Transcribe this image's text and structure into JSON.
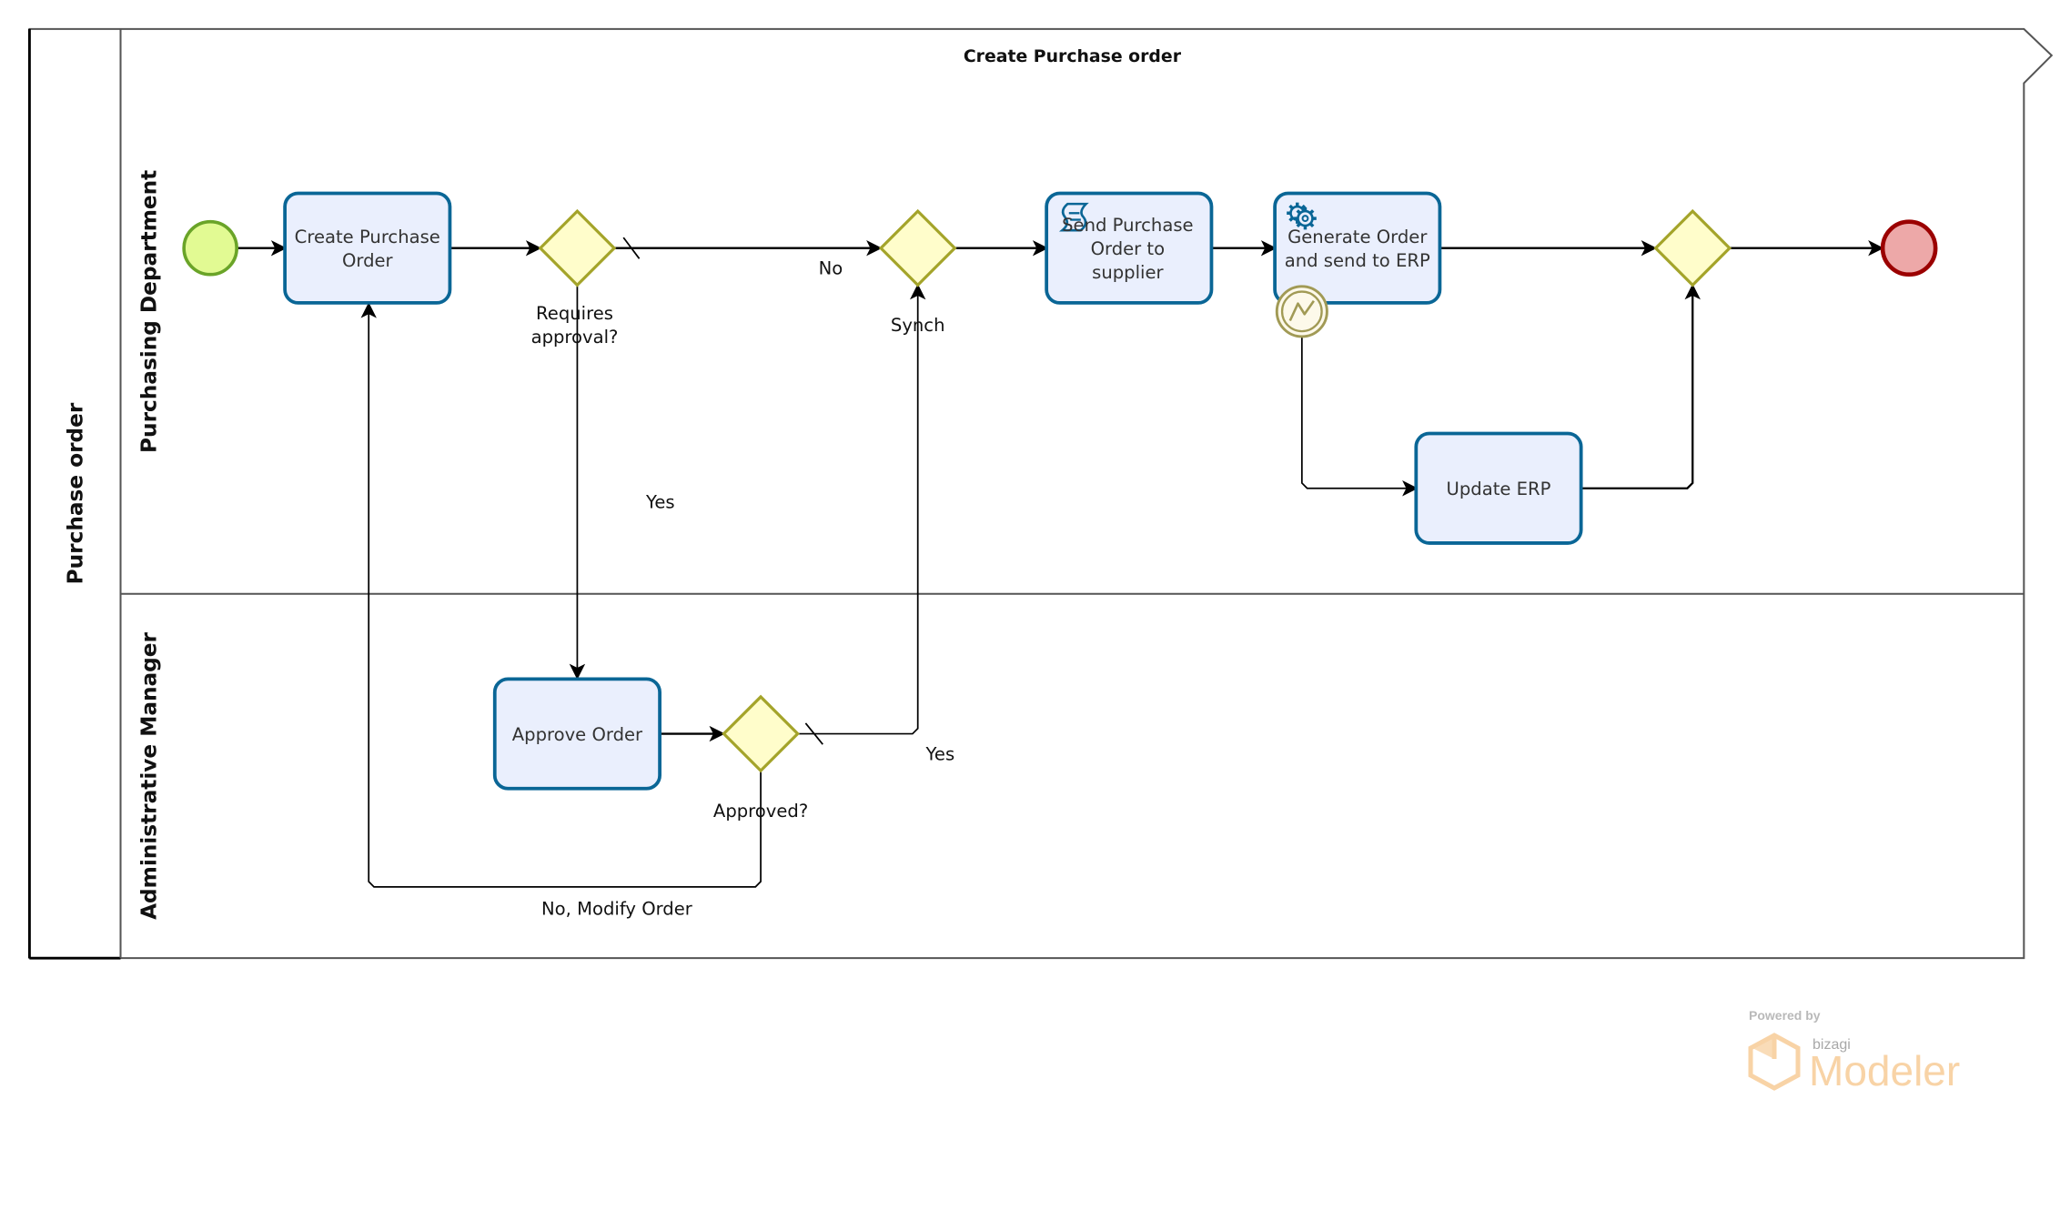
{
  "diagram": {
    "title": "Create Purchase order",
    "pool": {
      "label": "Purchase order"
    },
    "lanes": [
      {
        "id": "purchasing",
        "label": "Purchasing Department"
      },
      {
        "id": "admin",
        "label": "Administrative Manager"
      }
    ],
    "nodes": [
      {
        "id": "start",
        "type": "start-event",
        "label": ""
      },
      {
        "id": "create_po",
        "type": "task",
        "label": [
          "Create Purchase",
          "Order"
        ]
      },
      {
        "id": "gw_requires",
        "type": "exclusive-gateway",
        "label": [
          "Requires",
          "approval?"
        ]
      },
      {
        "id": "gw_synch",
        "type": "exclusive-gateway",
        "label": [
          "Synch"
        ]
      },
      {
        "id": "send_po",
        "type": "script-task",
        "icon": "script-icon",
        "label": [
          "Send Purchase",
          "Order to",
          "supplier"
        ]
      },
      {
        "id": "generate",
        "type": "service-task",
        "icon": "gear-icon",
        "label": [
          "Generate Order",
          "and send to ERP"
        ]
      },
      {
        "id": "boundary_error",
        "type": "boundary-error-event",
        "icon": "error-bolt-icon",
        "label": ""
      },
      {
        "id": "update_erp",
        "type": "task",
        "label": [
          "Update ERP"
        ]
      },
      {
        "id": "gw_merge",
        "type": "exclusive-gateway",
        "label": []
      },
      {
        "id": "end",
        "type": "end-event",
        "label": ""
      },
      {
        "id": "approve",
        "type": "task",
        "label": [
          "Approve Order"
        ]
      },
      {
        "id": "gw_approved",
        "type": "exclusive-gateway",
        "label": [
          "Approved?"
        ]
      }
    ],
    "flows": [
      {
        "from": "start",
        "to": "create_po",
        "label": ""
      },
      {
        "from": "create_po",
        "to": "gw_requires",
        "label": ""
      },
      {
        "from": "gw_requires",
        "to": "gw_synch",
        "label": "No",
        "default": true
      },
      {
        "from": "gw_requires",
        "to": "approve",
        "label": "Yes"
      },
      {
        "from": "gw_synch",
        "to": "send_po",
        "label": ""
      },
      {
        "from": "send_po",
        "to": "generate",
        "label": ""
      },
      {
        "from": "generate",
        "to": "gw_merge",
        "label": ""
      },
      {
        "from": "boundary_error",
        "to": "update_erp",
        "label": ""
      },
      {
        "from": "update_erp",
        "to": "gw_merge",
        "label": ""
      },
      {
        "from": "gw_merge",
        "to": "end",
        "label": ""
      },
      {
        "from": "approve",
        "to": "gw_approved",
        "label": ""
      },
      {
        "from": "gw_approved",
        "to": "gw_synch",
        "label": "Yes",
        "default": true
      },
      {
        "from": "gw_approved",
        "to": "create_po",
        "label": "No, Modify Order"
      }
    ],
    "colors": {
      "task_fill": "#eaeffd",
      "task_stroke": "#0a6696",
      "gateway_fill": "#fffdcb",
      "gateway_stroke": "#a4a42a",
      "start_fill": "#e2fa93",
      "start_stroke": "#6aa428",
      "end_fill": "#eda8a8",
      "end_stroke": "#9b0000",
      "boundary_fill": "#fdf9ea",
      "boundary_stroke": "#a19a55",
      "pool_stroke": "#555555"
    }
  },
  "watermark": {
    "powered_by": "Powered by",
    "brand": "bizagi",
    "product": "Modeler"
  }
}
